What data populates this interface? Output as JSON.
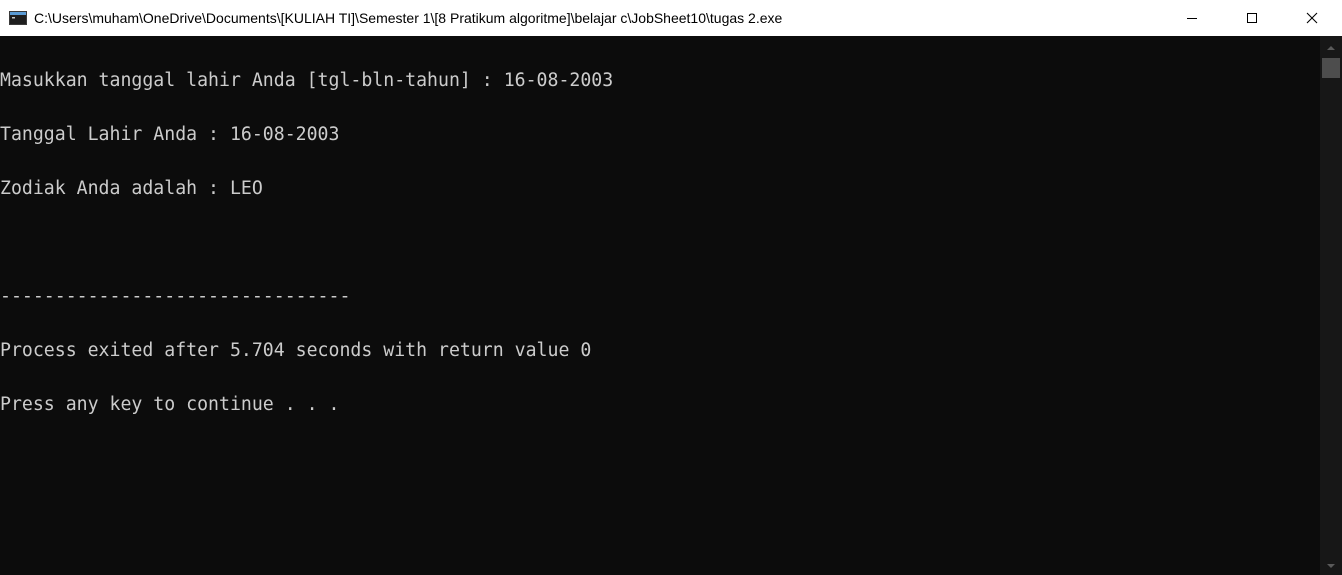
{
  "window": {
    "title": "C:\\Users\\muham\\OneDrive\\Documents\\[KULIAH TI]\\Semester 1\\[8 Pratikum algoritme]\\belajar c\\JobSheet10\\tugas 2.exe",
    "icon": "console-app-icon",
    "controls": {
      "minimize": "minimize-icon",
      "maximize": "maximize-icon",
      "close": "close-icon"
    }
  },
  "console": {
    "lines": [
      "Masukkan tanggal lahir Anda [tgl-bln-tahun] : 16-08-2003",
      "Tanggal Lahir Anda : 16-08-2003",
      "Zodiak Anda adalah : LEO",
      "",
      "--------------------------------",
      "Process exited after 5.704 seconds with return value 0",
      "Press any key to continue . . ."
    ]
  },
  "colors": {
    "background": "#0c0c0c",
    "text": "#cccccc",
    "titlebar": "#ffffff",
    "scrollbar_track": "#171717",
    "scrollbar_thumb": "#4d4d4d"
  }
}
